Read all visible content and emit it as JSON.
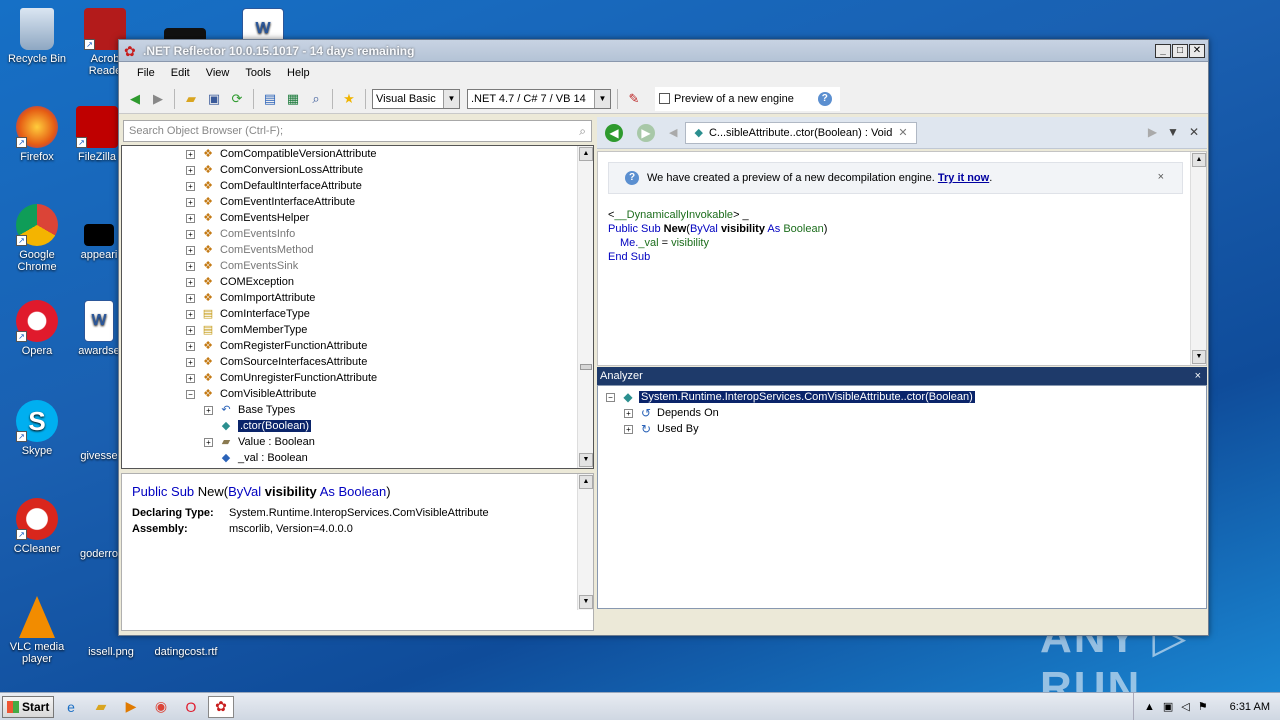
{
  "desktop_icons": [
    {
      "name": "recycle-bin-icon",
      "label": "Recycle Bin"
    },
    {
      "name": "acrobat-icon",
      "label": "Acrob\nReade"
    },
    {
      "name": "firefox-icon",
      "label": "Firefox"
    },
    {
      "name": "filezilla-icon",
      "label": "FileZilla"
    },
    {
      "name": "chrome-icon",
      "label": "Google\nChrome"
    },
    {
      "name": "appear-icon",
      "label": "appeari"
    },
    {
      "name": "opera-icon",
      "label": "Opera"
    },
    {
      "name": "awardse-icon",
      "label": "awardse"
    },
    {
      "name": "skype-icon",
      "label": "Skype"
    },
    {
      "name": "givesse-icon",
      "label": "givesse"
    },
    {
      "name": "ccleaner-icon",
      "label": "CCleaner"
    },
    {
      "name": "goderro-icon",
      "label": "goderro"
    },
    {
      "name": "vlc-icon",
      "label": "VLC media\nplayer"
    },
    {
      "name": "issell-icon",
      "label": "issell.png"
    },
    {
      "name": "datingcost-icon",
      "label": "datingcost.rtf"
    }
  ],
  "window": {
    "title": ".NET Reflector 10.0.15.1017 - 14 days remaining",
    "min": "_",
    "max": "□",
    "close": "✕"
  },
  "menu": [
    "File",
    "Edit",
    "View",
    "Tools",
    "Help"
  ],
  "toolbar": {
    "language": "Visual Basic",
    "framework": ".NET 4.7 / C# 7 / VB 14",
    "preview_label": "Preview of a new engine",
    "help": "?"
  },
  "search": {
    "placeholder": "Search Object Browser (Ctrl-F);"
  },
  "tree": [
    {
      "label": "ComCompatibleVersionAttribute",
      "exp": "+",
      "gray": false,
      "icon": "class-icon"
    },
    {
      "label": "ComConversionLossAttribute",
      "exp": "+",
      "gray": false,
      "icon": "class-icon"
    },
    {
      "label": "ComDefaultInterfaceAttribute",
      "exp": "+",
      "gray": false,
      "icon": "class-icon"
    },
    {
      "label": "ComEventInterfaceAttribute",
      "exp": "+",
      "gray": false,
      "icon": "class-icon"
    },
    {
      "label": "ComEventsHelper",
      "exp": "+",
      "gray": false,
      "icon": "class-icon"
    },
    {
      "label": "ComEventsInfo",
      "exp": "+",
      "gray": true,
      "icon": "class-icon"
    },
    {
      "label": "ComEventsMethod",
      "exp": "+",
      "gray": true,
      "icon": "class-icon"
    },
    {
      "label": "ComEventsSink",
      "exp": "+",
      "gray": true,
      "icon": "class-icon"
    },
    {
      "label": "COMException",
      "exp": "+",
      "gray": false,
      "icon": "class-icon"
    },
    {
      "label": "ComImportAttribute",
      "exp": "+",
      "gray": false,
      "icon": "class-icon"
    },
    {
      "label": "ComInterfaceType",
      "exp": "+",
      "gray": false,
      "icon": "enum-icon"
    },
    {
      "label": "ComMemberType",
      "exp": "+",
      "gray": false,
      "icon": "enum-icon"
    },
    {
      "label": "ComRegisterFunctionAttribute",
      "exp": "+",
      "gray": false,
      "icon": "class-icon"
    },
    {
      "label": "ComSourceInterfacesAttribute",
      "exp": "+",
      "gray": false,
      "icon": "class-icon"
    },
    {
      "label": "ComUnregisterFunctionAttribute",
      "exp": "+",
      "gray": false,
      "icon": "class-icon"
    },
    {
      "label": "ComVisibleAttribute",
      "exp": "−",
      "gray": false,
      "icon": "class-icon"
    }
  ],
  "tree_children": [
    {
      "label": "Base Types",
      "exp": "+",
      "icon": "base-types-icon"
    },
    {
      "label": ".ctor(Boolean)",
      "exp": "",
      "icon": "method-icon",
      "selected": true
    },
    {
      "label": "Value : Boolean",
      "exp": "+",
      "icon": "property-icon"
    },
    {
      "label": "_val : Boolean",
      "exp": "",
      "icon": "field-icon"
    }
  ],
  "details": {
    "sig_kw1": "Public Sub",
    "sig_name": "New",
    "sig_open": "(",
    "sig_kw2": "ByVal",
    "sig_param": "visibility",
    "sig_kw3": "As",
    "sig_type": "Boolean",
    "sig_close": ")",
    "declaring_label": "Declaring Type:",
    "declaring_value": "System.Runtime.InteropServices.ComVisibleAttribute",
    "assembly_label": "Assembly:",
    "assembly_value": "mscorlib, Version=4.0.0.0"
  },
  "code_tab": {
    "label": "C...sibleAttribute..ctor(Boolean) : Void",
    "close": "✕"
  },
  "infobar": {
    "text": "We have created a preview of a new decompilation engine.",
    "link": "Try it now",
    "after": ".",
    "close": "×"
  },
  "code": {
    "l1_a": "<",
    "l1_attr": "__DynamicallyInvokable",
    "l1_b": "> _",
    "l2_kw": "Public Sub",
    "l2_name": "New",
    "l2_open": "(",
    "l2_kw2": "ByVal",
    "l2_p": "visibility",
    "l2_kw3": "As",
    "l2_t": "Boolean",
    "l2_close": ")",
    "l3_a": "Me.",
    "l3_b": "_val",
    "l3_c": " = ",
    "l3_d": "visibility",
    "l4": "End Sub"
  },
  "analyzer": {
    "title": "Analyzer",
    "close": "×",
    "root": "System.Runtime.InteropServices.ComVisibleAttribute..ctor(Boolean)",
    "children": [
      "Depends On",
      "Used By"
    ]
  },
  "taskbar": {
    "start": "Start",
    "time": "6:31 AM"
  },
  "watermark": "ANY ▷ RUN"
}
